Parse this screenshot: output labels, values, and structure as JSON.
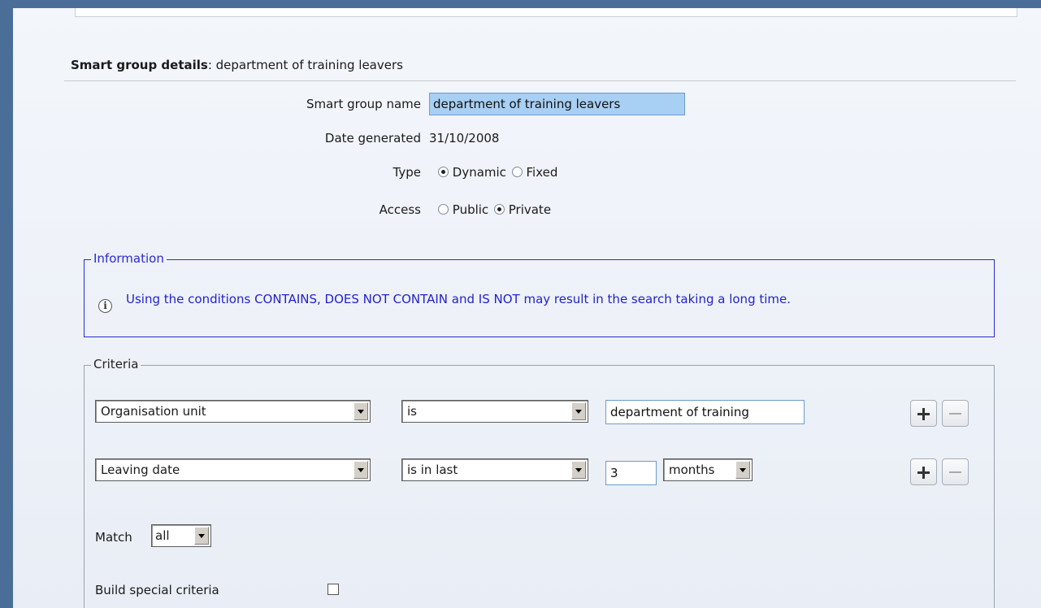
{
  "header": {
    "title_bold": "Smart group details",
    "title_rest": ": department of training leavers"
  },
  "form": {
    "name_label": "Smart group name",
    "name_value": "department of training leavers",
    "date_label": "Date generated",
    "date_value": "31/10/2008",
    "type_label": "Type",
    "type_options": [
      {
        "label": "Dynamic",
        "selected": true
      },
      {
        "label": "Fixed",
        "selected": false
      }
    ],
    "access_label": "Access",
    "access_options": [
      {
        "label": "Public",
        "selected": false
      },
      {
        "label": "Private",
        "selected": true
      }
    ]
  },
  "information": {
    "legend": "Information",
    "message": "Using the conditions CONTAINS, DOES NOT CONTAIN and IS NOT may result in the search taking a long time."
  },
  "criteria": {
    "legend": "Criteria",
    "rows": [
      {
        "field": "Organisation unit",
        "condition": "is",
        "value": "department of training"
      },
      {
        "field": "Leaving date",
        "condition": "is in last",
        "value": "3",
        "unit": "months"
      }
    ],
    "match_label": "Match",
    "match_value": "all",
    "special_label": "Build special criteria"
  }
}
